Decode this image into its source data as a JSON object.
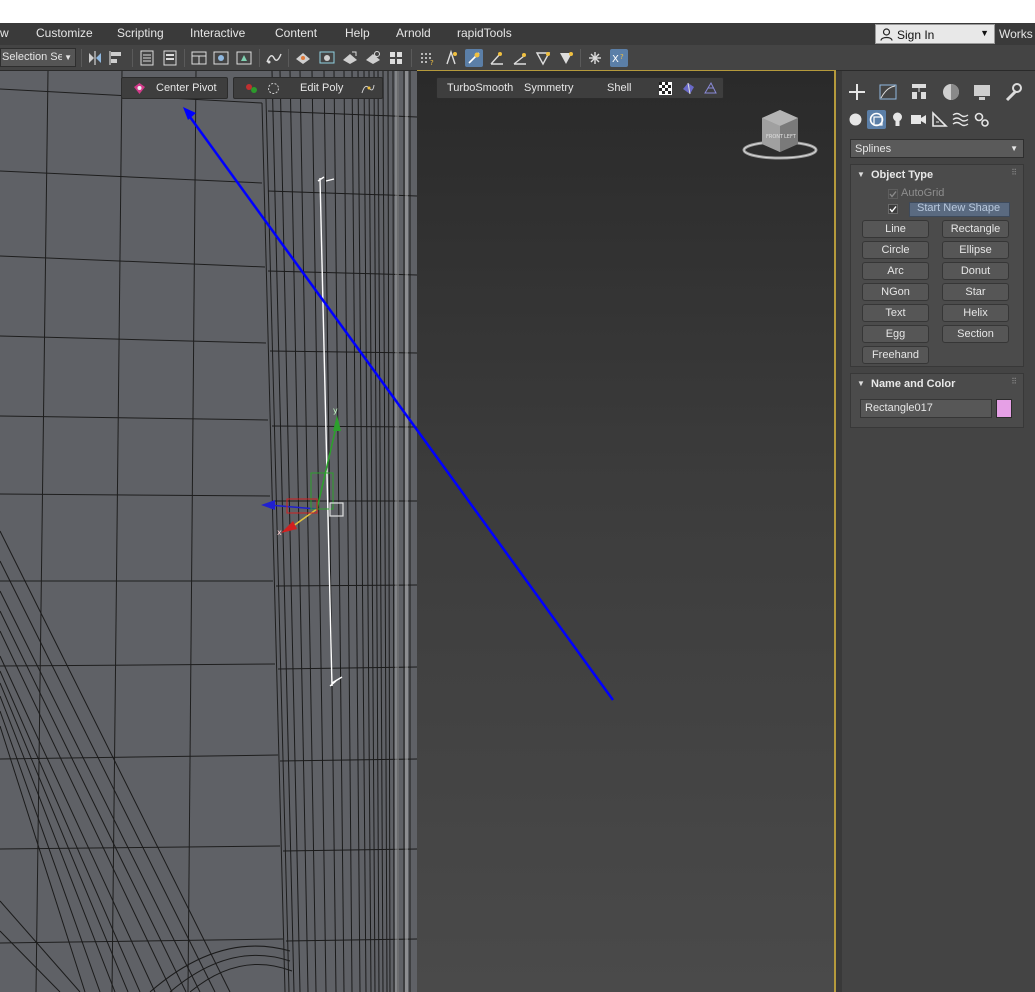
{
  "menu": {
    "items": [
      "w",
      "Customize",
      "Scripting",
      "Interactive",
      "Content",
      "Help",
      "Arnold",
      "rapidTools"
    ],
    "sign_in": "Sign In",
    "workspace": "Works"
  },
  "toolbar": {
    "selection_set": "Selection Se"
  },
  "ribbon": {
    "center_pivot": "Center Pivot",
    "edit_poly": "Edit Poly",
    "turbosmooth": "TurboSmooth",
    "symmetry": "Symmetry",
    "shell": "Shell"
  },
  "command_panel": {
    "category": "Splines",
    "object_type": {
      "title": "Object Type",
      "autogrid": "AutoGrid",
      "start_new_shape": "Start New Shape",
      "buttons": [
        "Line",
        "Rectangle",
        "Circle",
        "Ellipse",
        "Arc",
        "Donut",
        "NGon",
        "Star",
        "Text",
        "Helix",
        "Egg",
        "Section",
        "Freehand"
      ]
    },
    "name_and_color": {
      "title": "Name and Color",
      "name": "Rectangle017",
      "color": "#e6a0e6"
    }
  },
  "colors": {
    "annotation_arrow": "#0000ff",
    "active_viewport_border": "#b59a3c",
    "active_button": "#5b7fa8"
  }
}
